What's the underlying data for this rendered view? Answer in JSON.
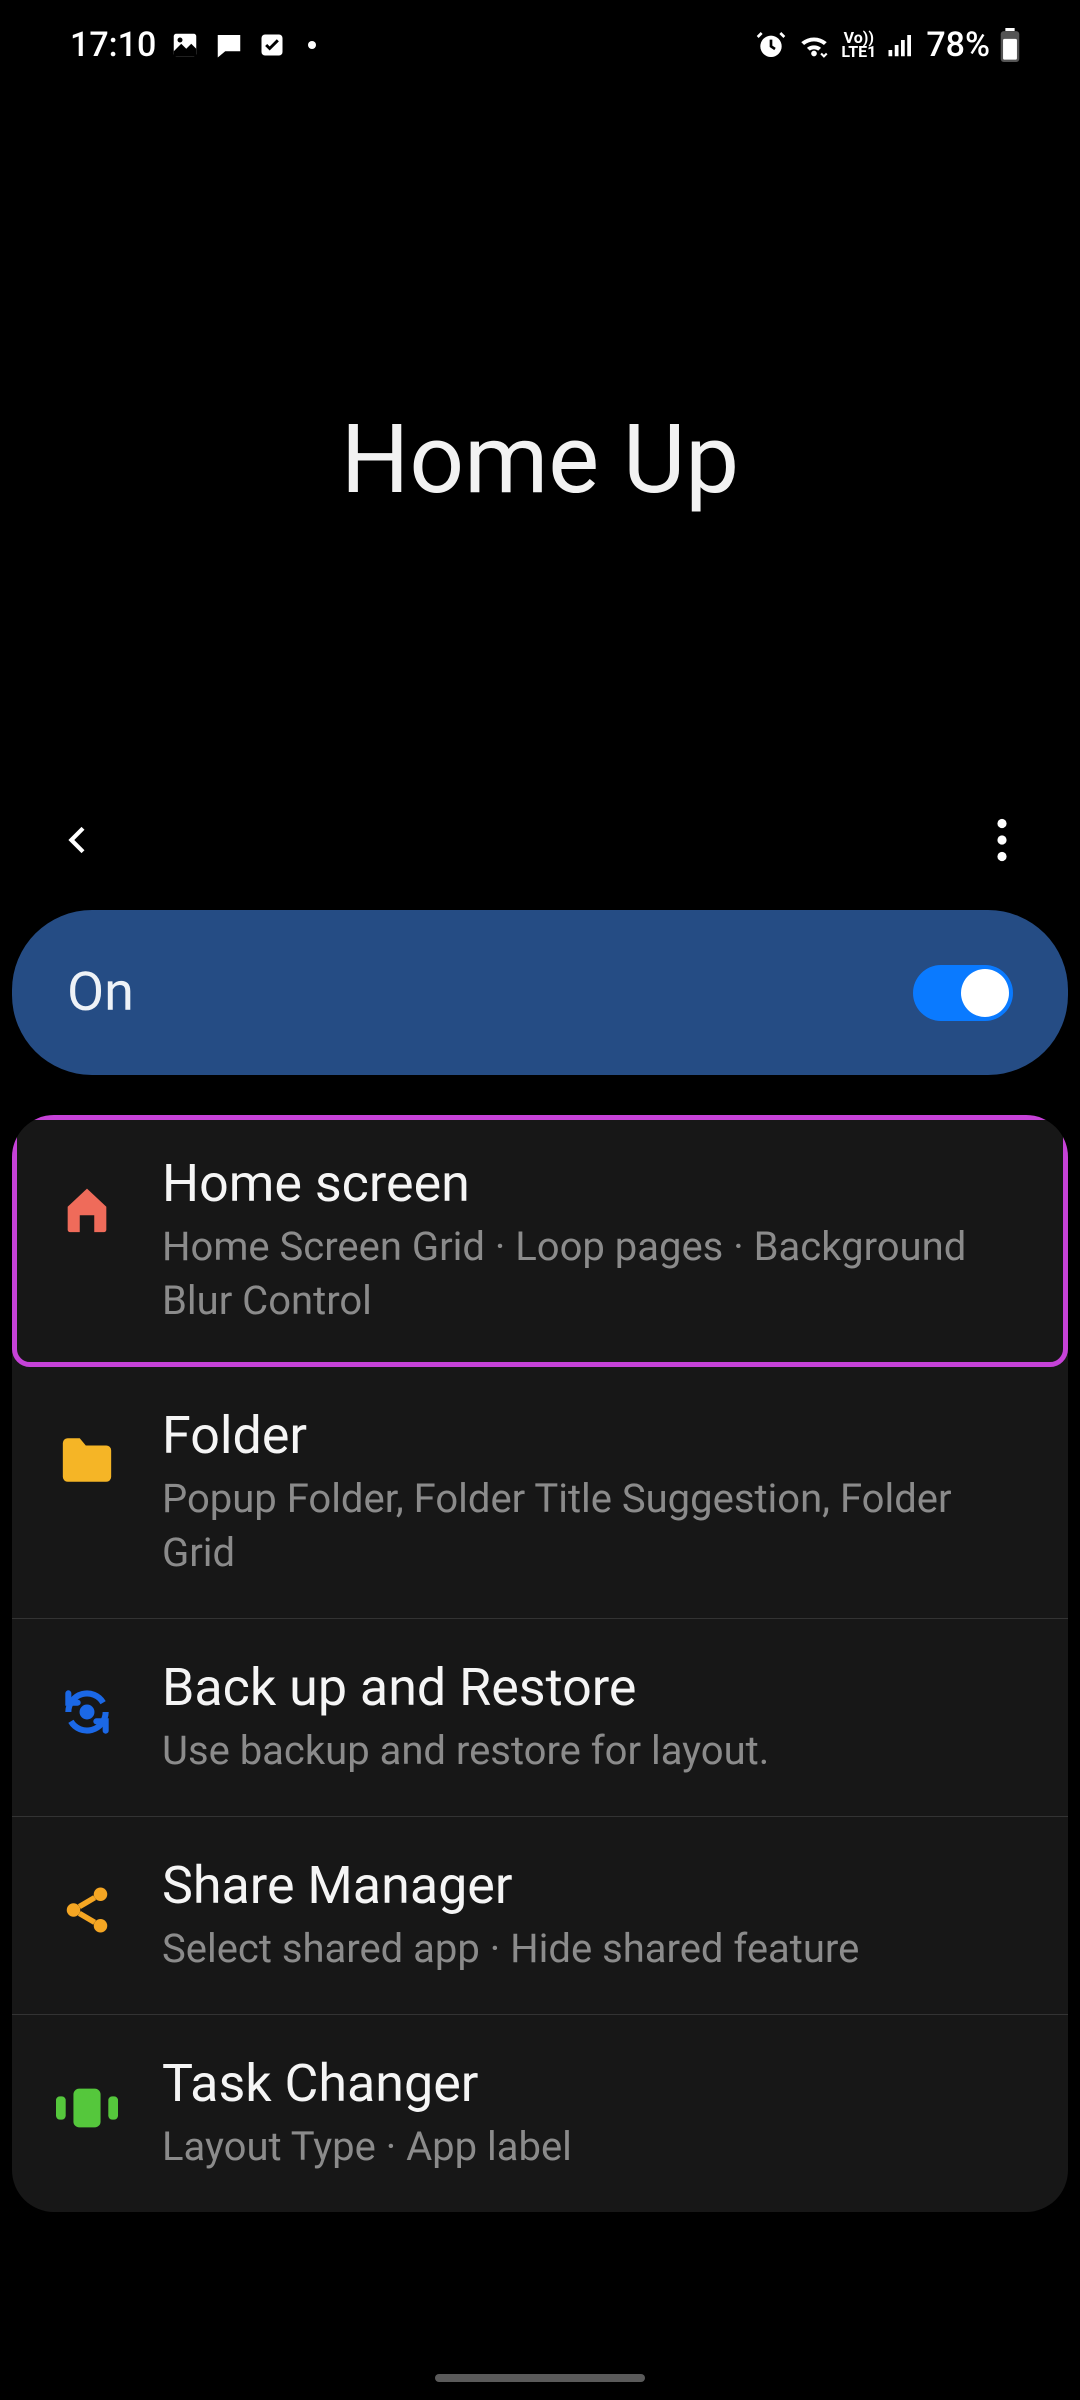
{
  "status_bar": {
    "time": "17:10",
    "battery_text": "78%",
    "network_label": "LTE1",
    "vo_label": "Vo))"
  },
  "hero": {
    "title": "Home Up"
  },
  "toggle": {
    "label": "On",
    "on": true
  },
  "items": [
    {
      "title": "Home screen",
      "sub": "Home Screen Grid · Loop pages · Background Blur Control",
      "highlighted": true
    },
    {
      "title": "Folder",
      "sub": "Popup Folder, Folder Title Suggestion, Folder Grid",
      "highlighted": false
    },
    {
      "title": "Back up and Restore",
      "sub": "Use backup and restore for layout.",
      "highlighted": false
    },
    {
      "title": "Share Manager",
      "sub": "Select shared app · Hide shared feature",
      "highlighted": false
    },
    {
      "title": "Task Changer",
      "sub": "Layout Type · App label",
      "highlighted": false
    }
  ]
}
